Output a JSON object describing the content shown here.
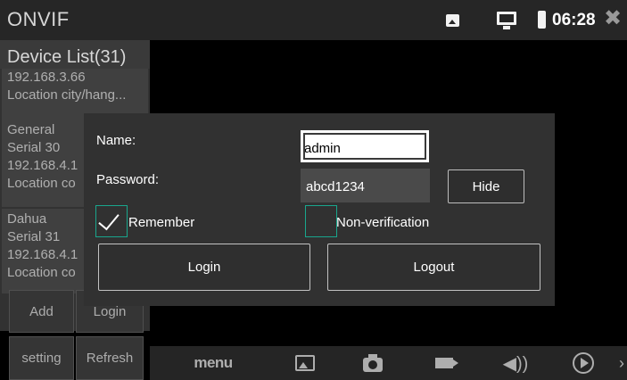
{
  "app": {
    "title": "ONVIF"
  },
  "status_bar": {
    "time": "06:28",
    "icons": [
      "gallery-icon",
      "monitor-icon",
      "battery-icon",
      "close-icon"
    ],
    "close_glyph": "✖"
  },
  "device_list": {
    "title": "Device List(31)",
    "items": [
      {
        "lines": [
          "192.168.3.66",
          "Location city/hang..."
        ]
      },
      {
        "lines": [
          "General",
          "Serial 30",
          "192.168.4.1",
          "Location co"
        ]
      },
      {
        "lines": [
          "Dahua",
          "Serial 31",
          "192.168.4.1",
          "Location co"
        ]
      }
    ]
  },
  "side_buttons": {
    "add": "Add",
    "login": "Login",
    "setting": "setting",
    "refresh": "Refresh"
  },
  "toolbar": {
    "menu": "menu",
    "volume_glyph": "◀))",
    "next_glyph": "›",
    "icons": [
      "picture-icon",
      "camera-icon",
      "video-icon",
      "volume-icon",
      "play-icon",
      "next-icon"
    ]
  },
  "login_dialog": {
    "name_label": "Name:",
    "name_value": "admin",
    "password_label": "Password:",
    "password_value": "abcd1234",
    "hide_label": "Hide",
    "remember_label": "Remember",
    "remember_checked": true,
    "nonverification_label": "Non-verification",
    "nonverification_checked": false,
    "login_label": "Login",
    "logout_label": "Logout"
  },
  "colors": {
    "checkbox_border": "#19a68d",
    "topbar": "#262626",
    "dialog": "#313131"
  }
}
